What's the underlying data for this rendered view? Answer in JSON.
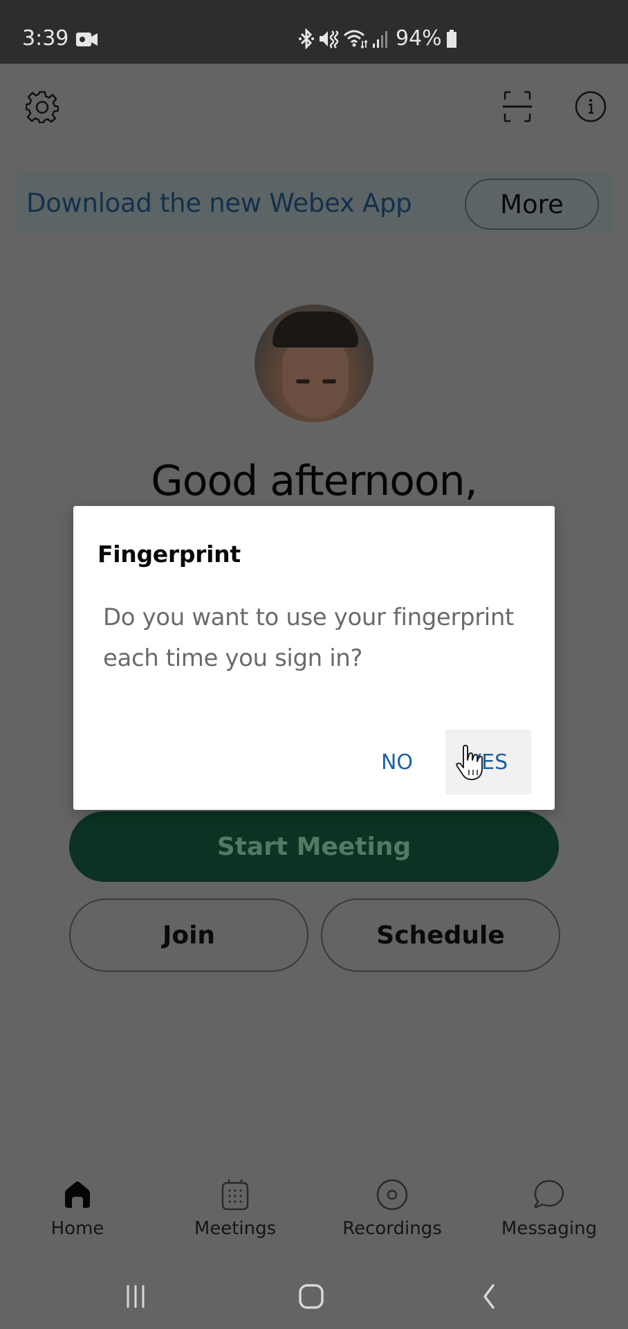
{
  "status_bar": {
    "time": "3:39",
    "battery_percent": "94%",
    "icons": [
      "video-camera-icon",
      "bluetooth-icon",
      "vibrate-mute-icon",
      "wifi-icon",
      "signal-icon",
      "battery-icon"
    ]
  },
  "header": {
    "icons": [
      "gear-icon",
      "scan-icon",
      "info-icon"
    ]
  },
  "banner": {
    "text": "Download the new Webex App",
    "button_label": "More"
  },
  "greeting": "Good afternoon,",
  "actions": {
    "start_meeting": "Start Meeting",
    "join": "Join",
    "schedule": "Schedule"
  },
  "bottom_nav": {
    "active": "Home",
    "items": [
      {
        "label": "Home",
        "icon": "home-icon"
      },
      {
        "label": "Meetings",
        "icon": "calendar-icon"
      },
      {
        "label": "Recordings",
        "icon": "recording-icon"
      },
      {
        "label": "Messaging",
        "icon": "chat-bubble-icon"
      }
    ]
  },
  "system_nav": {
    "icons": [
      "recents-icon",
      "home-button-icon",
      "back-icon"
    ]
  },
  "dialog": {
    "title": "Fingerprint",
    "message": "Do you want to use your fingerprint each time you sign in?",
    "no_label": "NO",
    "yes_label": "YES"
  },
  "colors": {
    "scrim_background": "#646464",
    "status_bar": "#2d2e2c",
    "primary_green": "#0b3222",
    "dialog_button_text": "#1d5fa0",
    "banner_text": "#13304d"
  }
}
